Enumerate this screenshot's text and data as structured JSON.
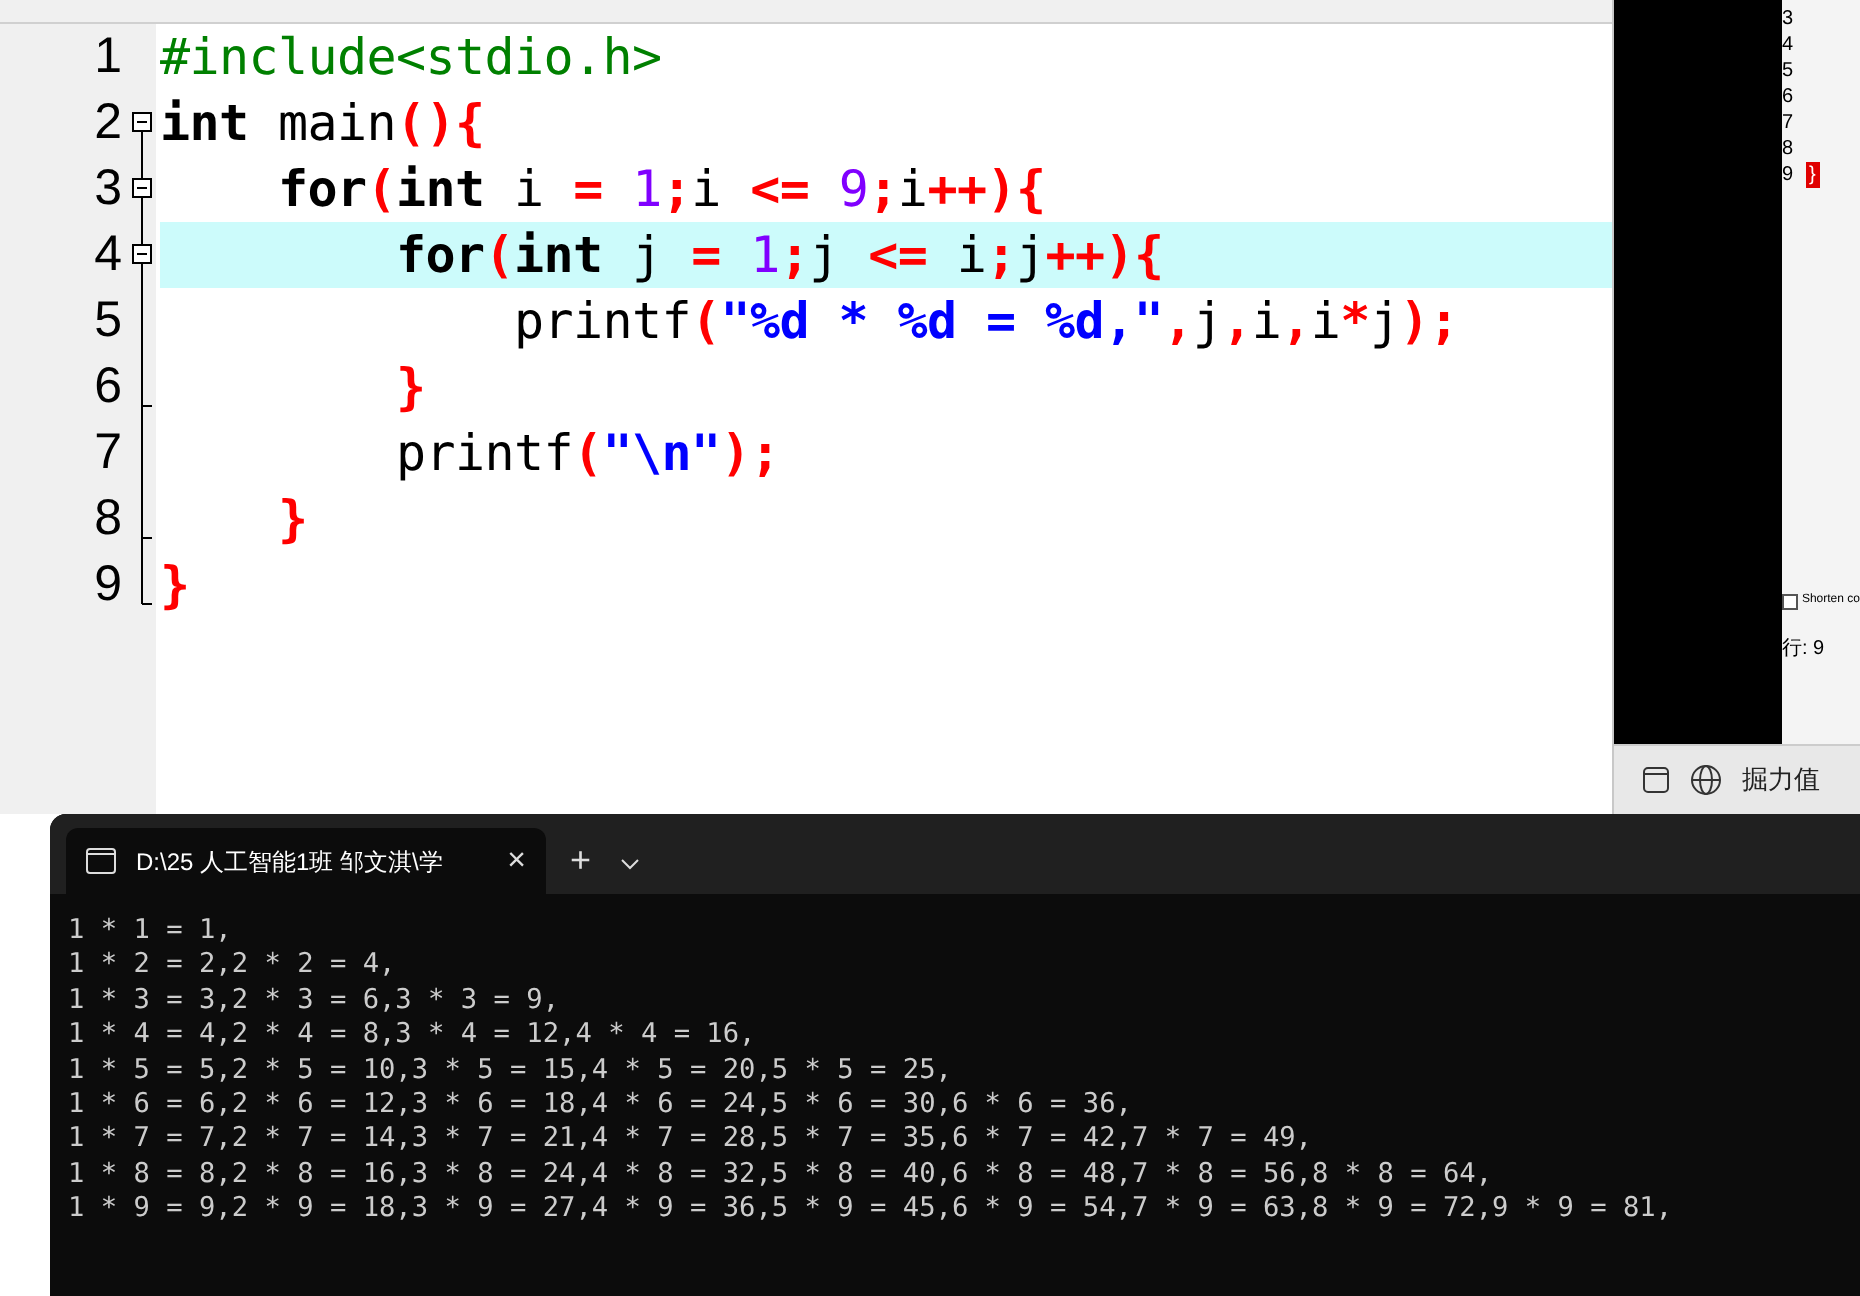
{
  "editor": {
    "lines": [
      {
        "number": "1",
        "kind": "plain",
        "highlighted": false,
        "tokens": [
          {
            "kind": "preprocessor",
            "text": "#include<stdio.h>"
          }
        ]
      },
      {
        "number": "2",
        "kind": "fold-start",
        "highlighted": false,
        "tokens": [
          {
            "kind": "keyword",
            "text": "int"
          },
          {
            "kind": "plain",
            "text": " main"
          },
          {
            "kind": "operator",
            "text": "(){"
          }
        ]
      },
      {
        "number": "3",
        "kind": "fold-start",
        "highlighted": false,
        "tokens": [
          {
            "kind": "keyword",
            "text": "    for"
          },
          {
            "kind": "operator",
            "text": "("
          },
          {
            "kind": "keyword",
            "text": "int"
          },
          {
            "kind": "plain",
            "text": " i "
          },
          {
            "kind": "operator",
            "text": "="
          },
          {
            "kind": "number",
            "text": " 1"
          },
          {
            "kind": "operator",
            "text": ";"
          },
          {
            "kind": "plain",
            "text": "i "
          },
          {
            "kind": "operator",
            "text": "<="
          },
          {
            "kind": "number",
            "text": " 9"
          },
          {
            "kind": "operator",
            "text": ";"
          },
          {
            "kind": "plain",
            "text": "i"
          },
          {
            "kind": "operator",
            "text": "++){"
          }
        ]
      },
      {
        "number": "4",
        "kind": "fold-start",
        "highlighted": true,
        "tokens": [
          {
            "kind": "keyword",
            "text": "        for"
          },
          {
            "kind": "operator",
            "text": "("
          },
          {
            "kind": "keyword",
            "text": "int"
          },
          {
            "kind": "plain",
            "text": " j "
          },
          {
            "kind": "operator",
            "text": "="
          },
          {
            "kind": "number",
            "text": " 1"
          },
          {
            "kind": "operator",
            "text": ";"
          },
          {
            "kind": "plain",
            "text": "j "
          },
          {
            "kind": "operator",
            "text": "<="
          },
          {
            "kind": "plain",
            "text": " i"
          },
          {
            "kind": "operator",
            "text": ";"
          },
          {
            "kind": "plain",
            "text": "j"
          },
          {
            "kind": "operator",
            "text": "++){"
          }
        ]
      },
      {
        "number": "5",
        "kind": "fold-body",
        "highlighted": false,
        "tokens": [
          {
            "kind": "plain",
            "text": "            printf"
          },
          {
            "kind": "operator",
            "text": "("
          },
          {
            "kind": "string",
            "text": "\"%d * %d = %d,\""
          },
          {
            "kind": "operator",
            "text": ","
          },
          {
            "kind": "plain",
            "text": "j"
          },
          {
            "kind": "operator",
            "text": ","
          },
          {
            "kind": "plain",
            "text": "i"
          },
          {
            "kind": "operator",
            "text": ","
          },
          {
            "kind": "plain",
            "text": "i"
          },
          {
            "kind": "operator",
            "text": "*"
          },
          {
            "kind": "plain",
            "text": "j"
          },
          {
            "kind": "operator",
            "text": ");"
          }
        ]
      },
      {
        "number": "6",
        "kind": "fold-close",
        "highlighted": false,
        "tokens": [
          {
            "kind": "operator",
            "text": "        }"
          }
        ]
      },
      {
        "number": "7",
        "kind": "fold-body",
        "highlighted": false,
        "tokens": [
          {
            "kind": "plain",
            "text": "        printf"
          },
          {
            "kind": "operator",
            "text": "("
          },
          {
            "kind": "string",
            "text": "\"\\n\""
          },
          {
            "kind": "operator",
            "text": ");"
          }
        ]
      },
      {
        "number": "8",
        "kind": "fold-close",
        "highlighted": false,
        "tokens": [
          {
            "kind": "operator",
            "text": "    }"
          }
        ]
      },
      {
        "number": "9",
        "kind": "fold-end",
        "highlighted": false,
        "tokens": [
          {
            "kind": "operator",
            "text": "}"
          }
        ]
      }
    ]
  },
  "side_window": {
    "line_numbers": [
      "3",
      "4",
      "5",
      "6",
      "7",
      "8",
      "9"
    ],
    "brace": "}",
    "option": {
      "label": "Shorten co",
      "checked": false
    },
    "status": "行: 9",
    "taskbar_label": "掘力值"
  },
  "terminal": {
    "tab": {
      "title": "D:\\25 人工智能1班 邹文淇\\学",
      "close": "×"
    },
    "new_tab": "+",
    "output": [
      "1 * 1 = 1,",
      "1 * 2 = 2,2 * 2 = 4,",
      "1 * 3 = 3,2 * 3 = 6,3 * 3 = 9,",
      "1 * 4 = 4,2 * 4 = 8,3 * 4 = 12,4 * 4 = 16,",
      "1 * 5 = 5,2 * 5 = 10,3 * 5 = 15,4 * 5 = 20,5 * 5 = 25,",
      "1 * 6 = 6,2 * 6 = 12,3 * 6 = 18,4 * 6 = 24,5 * 6 = 30,6 * 6 = 36,",
      "1 * 7 = 7,2 * 7 = 14,3 * 7 = 21,4 * 7 = 28,5 * 7 = 35,6 * 7 = 42,7 * 7 = 49,",
      "1 * 8 = 8,2 * 8 = 16,3 * 8 = 24,4 * 8 = 32,5 * 8 = 40,6 * 8 = 48,7 * 8 = 56,8 * 8 = 64,",
      "1 * 9 = 9,2 * 9 = 18,3 * 9 = 27,4 * 9 = 36,5 * 9 = 45,6 * 9 = 54,7 * 9 = 63,8 * 9 = 72,9 * 9 = 81,"
    ]
  }
}
